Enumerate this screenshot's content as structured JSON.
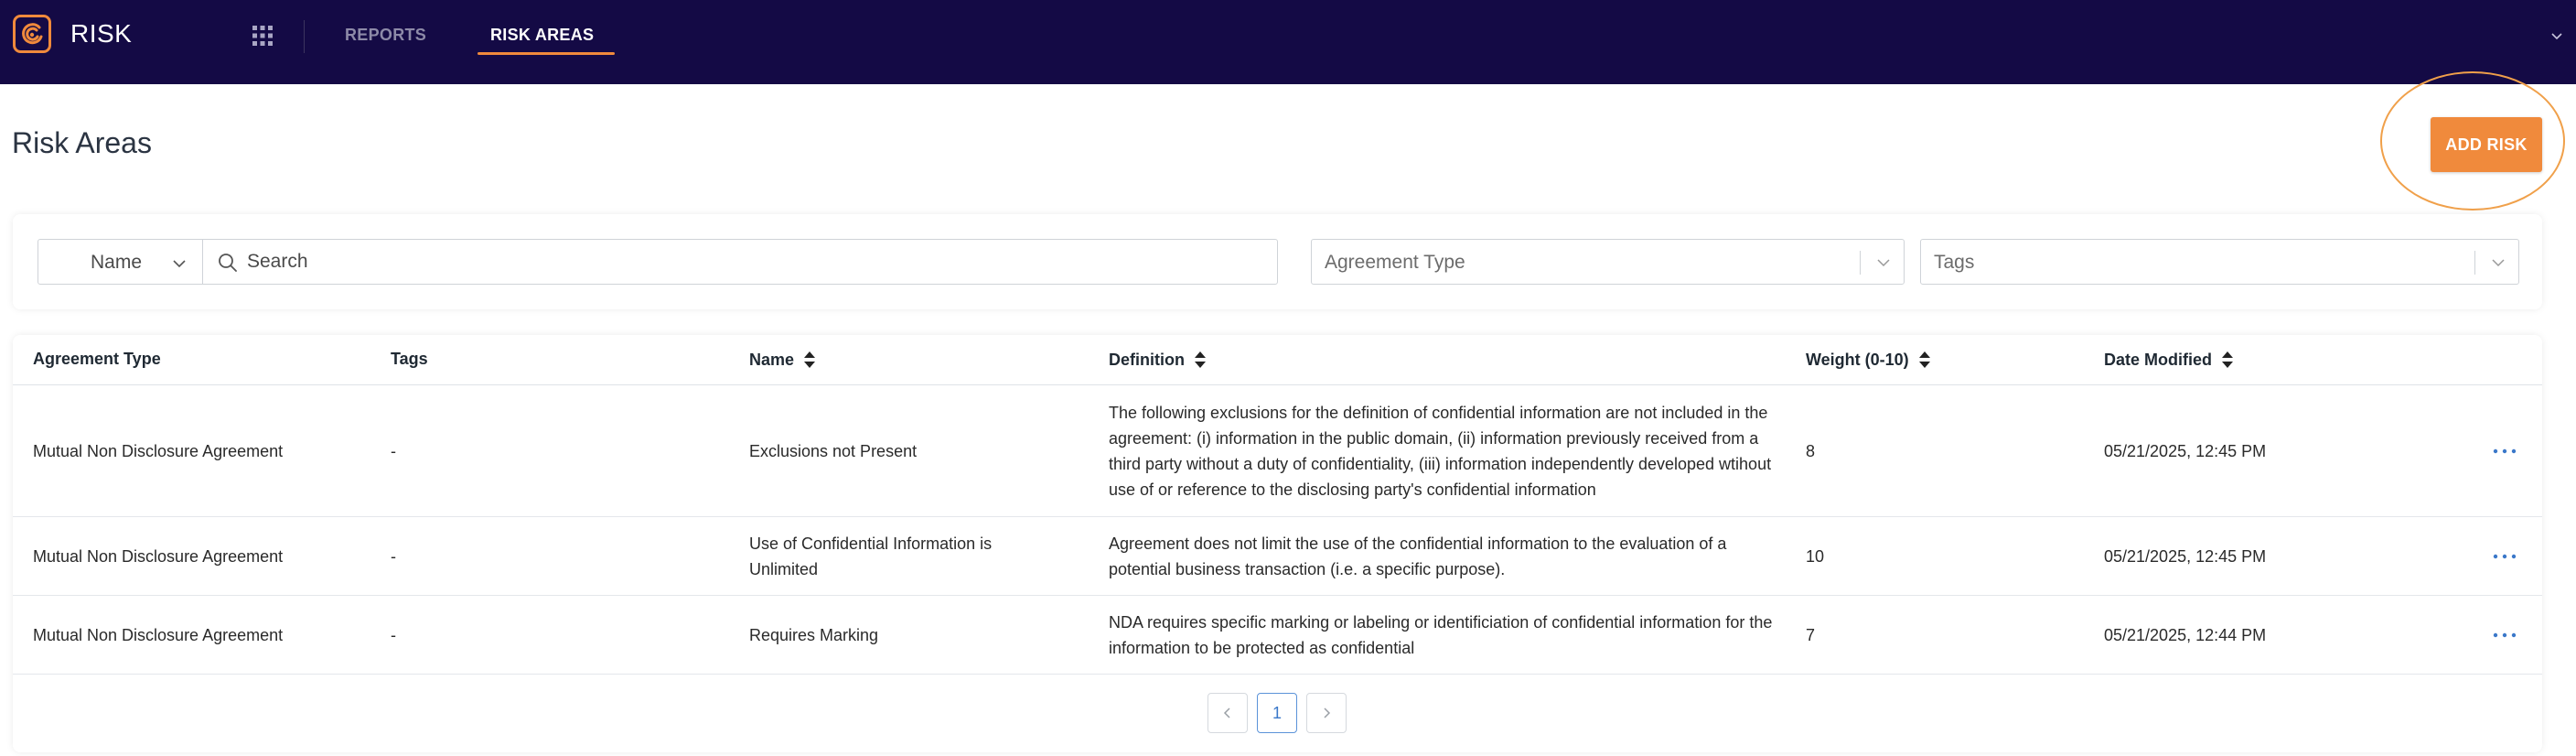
{
  "app": {
    "name": "RISK"
  },
  "nav": {
    "tabs": [
      {
        "label": "REPORTS",
        "active": false
      },
      {
        "label": "RISK AREAS",
        "active": true
      }
    ]
  },
  "page": {
    "title": "Risk Areas",
    "add_button_label": "ADD RISK"
  },
  "filters": {
    "field_select": "Name",
    "search_placeholder": "Search",
    "agreement_type_placeholder": "Agreement Type",
    "tags_placeholder": "Tags"
  },
  "table": {
    "columns": [
      {
        "label": "Agreement Type",
        "sortable": false
      },
      {
        "label": "Tags",
        "sortable": false
      },
      {
        "label": "Name",
        "sortable": true
      },
      {
        "label": "Definition",
        "sortable": true
      },
      {
        "label": "Weight (0-10)",
        "sortable": true
      },
      {
        "label": "Date Modified",
        "sortable": true
      }
    ],
    "rows": [
      {
        "agreement_type": "Mutual Non Disclosure Agreement",
        "tags": "-",
        "name": "Exclusions not Present",
        "definition": "The following exclusions for the definition of confidential information are not included in the agreement: (i) information in the public domain, (ii) information previously received from a third party without a duty of confidentiality, (iii) information independently developed wtihout use of or reference to the disclosing party's confidential information",
        "weight": "8",
        "date_modified": "05/21/2025, 12:45 PM"
      },
      {
        "agreement_type": "Mutual Non Disclosure Agreement",
        "tags": "-",
        "name": "Use of Confidential Information is Unlimited",
        "definition": "Agreement does not limit the use of the confidential information to the evaluation of a potential business transaction (i.e. a specific purpose).",
        "weight": "10",
        "date_modified": "05/21/2025, 12:45 PM"
      },
      {
        "agreement_type": "Mutual Non Disclosure Agreement",
        "tags": "-",
        "name": "Requires Marking",
        "definition": "NDA requires specific marking or labeling or identificiation of confidential information for the information to be protected as confidential",
        "weight": "7",
        "date_modified": "05/21/2025, 12:44 PM"
      }
    ]
  },
  "pagination": {
    "current_page": "1"
  },
  "colors": {
    "topbar": "#140a45",
    "accent": "#f08a3c",
    "link_blue": "#3a78c9"
  }
}
